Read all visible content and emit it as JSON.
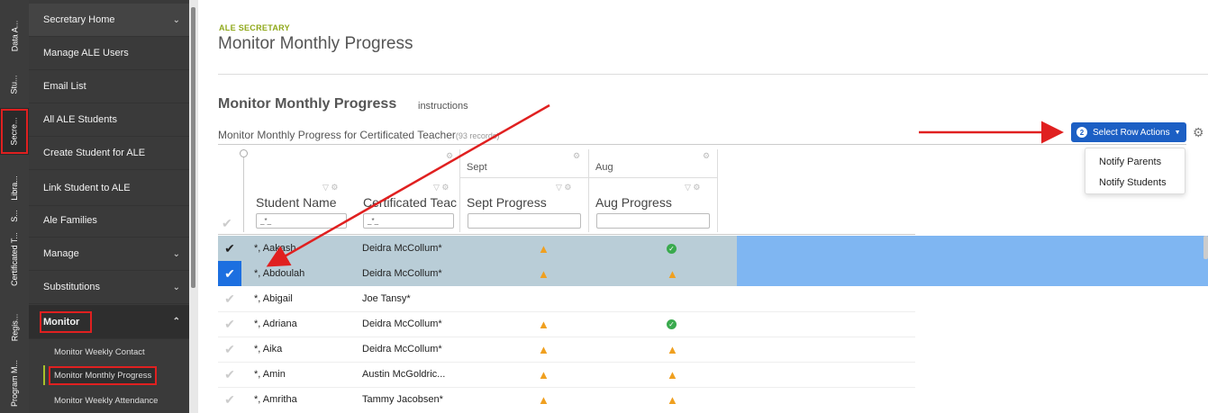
{
  "rail": {
    "items": [
      {
        "label": "Data A...",
        "selected": false
      },
      {
        "label": "Stu...",
        "selected": false
      },
      {
        "label": "Secre...",
        "selected": true
      },
      {
        "label": "Libra...",
        "selected": false
      },
      {
        "label": "S...",
        "selected": false
      },
      {
        "label": "Certificated T...",
        "selected": false
      },
      {
        "label": "Regis...",
        "selected": false
      },
      {
        "label": "Program M...",
        "selected": false
      }
    ]
  },
  "sidebar": {
    "items": [
      {
        "label": "Secretary Home",
        "chevron": "v"
      },
      {
        "label": "Manage ALE Users"
      },
      {
        "label": "Email List"
      },
      {
        "label": "All ALE Students"
      },
      {
        "label": "Create Student for ALE"
      },
      {
        "label": "Link Student to ALE"
      },
      {
        "label": "Ale Families"
      },
      {
        "label": "Manage",
        "chevron": "v"
      },
      {
        "label": "Substitutions",
        "chevron": "v"
      },
      {
        "label": "Monitor",
        "chevron": "^"
      }
    ],
    "sub_items": [
      {
        "label": "Monitor Weekly Contact"
      },
      {
        "label": "Monitor Monthly Progress"
      },
      {
        "label": "Monitor Weekly Attendance"
      }
    ]
  },
  "header": {
    "section_label": "ALE SECRETARY",
    "title": "Monitor Monthly Progress"
  },
  "content": {
    "subtitle": "Monitor Monthly Progress",
    "instructions": "instructions",
    "grid_title": "Monitor Monthly Progress for Certificated Teacher",
    "record_count": "(93 records)",
    "select_actions_label": "Select Row Actions",
    "select_actions_badge": "2",
    "menu": [
      "Notify Parents",
      "Notify Students"
    ]
  },
  "columns": {
    "group_sept": "Sept",
    "group_aug": "Aug",
    "student": "Student Name",
    "teacher": "Certificated Teac",
    "sept": "Sept Progress",
    "aug": "Aug Progress",
    "filter_student": "_*_",
    "filter_teacher": "_*_"
  },
  "rows": [
    {
      "student": "*, Aakash",
      "teacher": "Deidra McCollum*",
      "sept": "warn",
      "aug": "ok",
      "checked": true,
      "highlight": true
    },
    {
      "student": "*, Abdoulah",
      "teacher": "Deidra McCollum*",
      "sept": "warn",
      "aug": "warn",
      "checked": true,
      "highlight": true
    },
    {
      "student": "*, Abigail",
      "teacher": "Joe Tansy*",
      "sept": "",
      "aug": "",
      "checked": false,
      "highlight": false
    },
    {
      "student": "*, Adriana",
      "teacher": "Deidra McCollum*",
      "sept": "warn",
      "aug": "ok",
      "checked": false,
      "highlight": false
    },
    {
      "student": "*, Aika",
      "teacher": "Deidra McCollum*",
      "sept": "warn",
      "aug": "warn",
      "checked": false,
      "highlight": false
    },
    {
      "student": "*, Amin",
      "teacher": "Austin McGoldric...",
      "sept": "warn",
      "aug": "warn",
      "checked": false,
      "highlight": false
    },
    {
      "student": "*, Amritha",
      "teacher": "Tammy Jacobsen*",
      "sept": "warn",
      "aug": "warn",
      "checked": false,
      "highlight": false
    }
  ],
  "colors": {
    "accent": "#1c5fc4",
    "annotation": "#e02020",
    "label_green": "#8fa81a",
    "row_highlight": "#b9cdd7",
    "row_extension": "#7fb6f2"
  }
}
